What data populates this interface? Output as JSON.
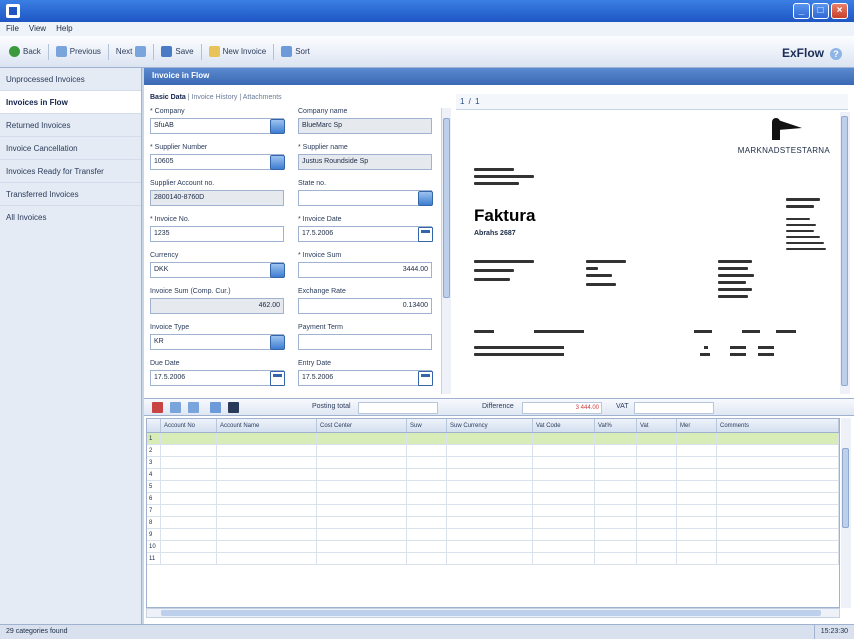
{
  "menu": [
    "File",
    "View",
    "Help"
  ],
  "toolbar": {
    "back": "Back",
    "previous": "Previous",
    "next": "Next",
    "save": "Save",
    "new_invoice": "New Invoice",
    "sort": "Sort"
  },
  "brand": "ExFlow",
  "nav": {
    "items": [
      "Unprocessed Invoices",
      "Invoices in Flow",
      "Returned Invoices",
      "Invoice Cancellation",
      "Invoices Ready for Transfer",
      "Transferred Invoices",
      "All Invoices"
    ]
  },
  "main": {
    "header": "Invoice in Flow",
    "tabs": [
      "Basic Data",
      "Invoice History",
      "Attachments"
    ]
  },
  "form": {
    "company_label": "* Company",
    "company_value": "SfuAB",
    "company_name_label": "Company name",
    "company_name_value": "BlueMarc Sp",
    "supplier_no_label": "* Supplier Number",
    "supplier_no_value": "10605",
    "supplier_name_label": "* Supplier name",
    "supplier_name_value": "Justus Roundside Sp",
    "supplier_account_label": "Supplier Account no.",
    "supplier_account_value": "2800140-8760D",
    "state_label": "State no.",
    "state_value": "",
    "invoice_no_label": "* Invoice No.",
    "invoice_no_value": "1235",
    "invoice_date_label": "* Invoice Date",
    "invoice_date_value": "17.5.2006",
    "currency_label": "Currency",
    "currency_value": "DKK",
    "invoice_sum_label": "* Invoice Sum",
    "invoice_sum_value": "3444.00",
    "invoice_sum_comp_label": "Invoice Sum (Comp. Cur.)",
    "invoice_sum_comp_value": "462.00",
    "exchange_rate_label": "Exchange Rate",
    "exchange_rate_value": "0.13400",
    "invoice_type_label": "Invoice Type",
    "invoice_type_value": "KR",
    "payment_term_label": "Payment Term",
    "payment_term_value": "",
    "due_date_label": "Due Date",
    "due_date_value": "17.5.2006",
    "entry_date_label": "Entry Date",
    "entry_date_value": "17.5.2006"
  },
  "pdf": {
    "toolbar_text": "1 / 1",
    "company": "MARKNADSTESTARNA",
    "title": "Faktura",
    "subtitle": "Abrahs 2687"
  },
  "gridbar": {
    "posting_total_label": "Posting total",
    "posting_total_value": "",
    "difference_label": "Difference",
    "difference_value": "3 444.00",
    "vat_label": "VAT",
    "vat_value": ""
  },
  "grid": {
    "columns": [
      "Account No",
      "Account Name",
      "Cost Center",
      "Suw",
      "Suw Currency",
      "Vat Code",
      "Vat%",
      "Vat",
      "Mer",
      "Comments"
    ],
    "rows": [
      "1",
      "2",
      "3",
      "4",
      "5",
      "6",
      "7",
      "8",
      "9",
      "10",
      "11"
    ]
  },
  "status": {
    "left": "29 categories found",
    "right": "15:23:30"
  }
}
